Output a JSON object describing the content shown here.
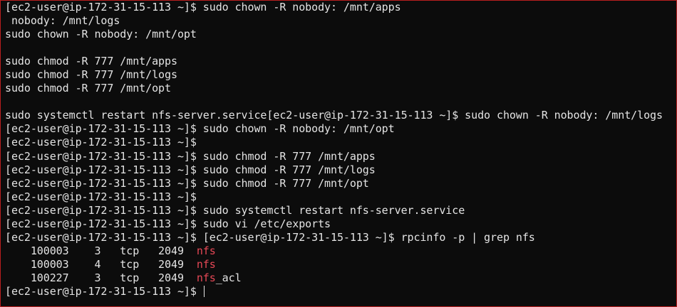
{
  "terminal": {
    "lines": [
      [
        {
          "t": "[ec2-user@ip-172-31-15-113 ~]$ sudo chown -R nobody: /mnt/apps"
        }
      ],
      [
        {
          "t": " nobody: /mnt/logs"
        }
      ],
      [
        {
          "t": "sudo chown -R nobody: /mnt/opt"
        }
      ],
      [
        {
          "t": ""
        }
      ],
      [
        {
          "t": "sudo chmod -R 777 /mnt/apps"
        }
      ],
      [
        {
          "t": "sudo chmod -R 777 /mnt/logs"
        }
      ],
      [
        {
          "t": "sudo chmod -R 777 /mnt/opt"
        }
      ],
      [
        {
          "t": ""
        }
      ],
      [
        {
          "t": "sudo systemctl restart nfs-server.service[ec2-user@ip-172-31-15-113 ~]$ sudo chown -R nobody: /mnt/logs"
        }
      ],
      [
        {
          "t": "[ec2-user@ip-172-31-15-113 ~]$ sudo chown -R nobody: /mnt/opt"
        }
      ],
      [
        {
          "t": "[ec2-user@ip-172-31-15-113 ~]$"
        }
      ],
      [
        {
          "t": "[ec2-user@ip-172-31-15-113 ~]$ sudo chmod -R 777 /mnt/apps"
        }
      ],
      [
        {
          "t": "[ec2-user@ip-172-31-15-113 ~]$ sudo chmod -R 777 /mnt/logs"
        }
      ],
      [
        {
          "t": "[ec2-user@ip-172-31-15-113 ~]$ sudo chmod -R 777 /mnt/opt"
        }
      ],
      [
        {
          "t": "[ec2-user@ip-172-31-15-113 ~]$"
        }
      ],
      [
        {
          "t": "[ec2-user@ip-172-31-15-113 ~]$ sudo systemctl restart nfs-server.service"
        }
      ],
      [
        {
          "t": "[ec2-user@ip-172-31-15-113 ~]$ sudo vi /etc/exports"
        }
      ],
      [
        {
          "t": "[ec2-user@ip-172-31-15-113 ~]$ [ec2-user@ip-172-31-15-113 ~]$ rpcinfo -p | grep nfs"
        }
      ],
      [
        {
          "t": "    100003    3   tcp   2049  "
        },
        {
          "t": "nfs",
          "hl": true
        }
      ],
      [
        {
          "t": "    100003    4   tcp   2049  "
        },
        {
          "t": "nfs",
          "hl": true
        }
      ],
      [
        {
          "t": "    100227    3   tcp   2049  "
        },
        {
          "t": "nfs",
          "hl": true
        },
        {
          "t": "_acl"
        }
      ],
      [
        {
          "t": "[ec2-user@ip-172-31-15-113 ~]$ "
        }
      ]
    ],
    "colors": {
      "background": "#0c0c0c",
      "foreground": "#e4e4e4",
      "match_highlight": "#e74856",
      "border": "#b91e1e"
    }
  }
}
